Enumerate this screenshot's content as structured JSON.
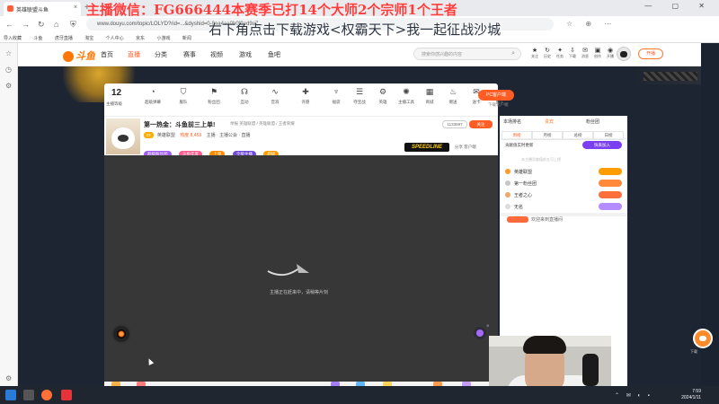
{
  "browser": {
    "tab_title": "英雄联盟斗鱼",
    "tab_close": "×",
    "new_tab": "+",
    "window_controls": "— ▢ ✕",
    "address": "www.douyu.com/topic/LOLYD?rid=...&dyshid=0-8ea4aa0b0f3ed9a7...",
    "nav_icons": "☆ ⊕ ⋯",
    "bookmarks": [
      "导入收藏",
      "斗鱼",
      "虎牙直播",
      "淘宝",
      "个人中心",
      "京东",
      "小游戏",
      "新闻"
    ]
  },
  "overlay": {
    "line1": "主播微信：FG666444本赛季已打14个大师2个宗师1个王者",
    "line2": "右下角点击下载游戏<权霸天下>我一起征战沙城"
  },
  "header": {
    "logo": "斗鱼",
    "nav": [
      "首页",
      "直播",
      "分类",
      "赛事",
      "视频",
      "游戏",
      "鱼吧"
    ],
    "search_placeholder": "搜索你感兴趣的内容",
    "search_icon": "⌕",
    "icons": [
      {
        "g": "★",
        "label": "关注"
      },
      {
        "g": "↻",
        "label": "历史"
      },
      {
        "g": "✦",
        "label": "任务"
      },
      {
        "g": "⇩",
        "label": "下载"
      },
      {
        "g": "✉",
        "label": "消息"
      },
      {
        "g": "▣",
        "label": "创作"
      },
      {
        "g": "◉",
        "label": "开播"
      }
    ],
    "open_btn": "开播"
  },
  "toolbar": {
    "count": "12",
    "count_label": "主播等级",
    "items": [
      {
        "g": "◔",
        "label": "超级弹幕"
      },
      {
        "g": "⛉",
        "label": "舰队"
      },
      {
        "g": "⚑",
        "label": "粉丝团"
      },
      {
        "g": "☊",
        "label": "互动"
      },
      {
        "g": "∿",
        "label": "音浪"
      },
      {
        "g": "✚",
        "label": "许愿"
      },
      {
        "g": "♆",
        "label": "福袋"
      },
      {
        "g": "☰",
        "label": "夺宝战"
      },
      {
        "g": "⚙",
        "label": "英雄"
      },
      {
        "g": "✺",
        "label": "主播工具"
      },
      {
        "g": "▦",
        "label": "商城"
      },
      {
        "g": "♨",
        "label": "赠送"
      },
      {
        "g": "✉",
        "label": "送卡"
      },
      {
        "g": "…",
        "label": "更多"
      }
    ],
    "pc_btn": "PC客户端",
    "pc_sub": "下载客户端"
  },
  "stream": {
    "title": "第一热金：斗鱼前三上单!",
    "meta": "举报  英雄联盟 / 英雄联盟 / 王者荣耀",
    "uid_badge": "ID",
    "host": "英雄联盟",
    "heat": "热度 8,453",
    "line2_rest": "主播 · 主播公会 · 直播",
    "pills": [
      "超级粉丝团",
      "斗鱼年度",
      "上单",
      "全能主播",
      "超级"
    ],
    "rank": "1133597",
    "follow": "关注",
    "share": "分享  客户端",
    "ad": "SPEEDLINE"
  },
  "video": {
    "loading": "主播正在赶来中，请稍等片刻",
    "close": "×"
  },
  "right": {
    "tabs": [
      "本场排名",
      "贵宾",
      "粉丝团"
    ],
    "subtabs": [
      "周榜",
      "月榜",
      "总榜",
      "日榜"
    ],
    "sub_label": "贡献值实时更新",
    "badge": "快来加入",
    "note": "本主播贡献值前五可上榜",
    "rows": [
      {
        "name": "英雄联盟"
      },
      {
        "name": "第一粉丝团"
      },
      {
        "name": "王者之心"
      },
      {
        "name": "无名"
      }
    ],
    "chat": "欢迎来到直播间"
  },
  "float": {
    "label": "下载"
  },
  "taskbar": {
    "clock_time": "7:59",
    "clock_date": "2024/1/11",
    "tray": "⌃ ✉ ◐ ▪"
  }
}
